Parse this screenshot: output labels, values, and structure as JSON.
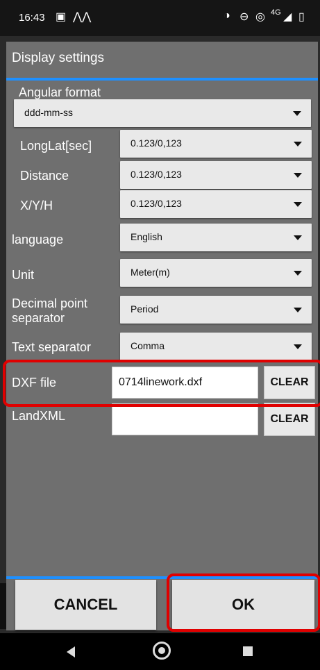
{
  "status": {
    "time": "16:43",
    "network": "4G"
  },
  "dialog": {
    "title": "Display settings",
    "angular_format": {
      "label": "Angular format",
      "value": "ddd-mm-ss"
    },
    "longlat": {
      "label": "LongLat[sec]",
      "value": "0.123/0,123"
    },
    "distance": {
      "label": "Distance",
      "value": "0.123/0,123"
    },
    "xyh": {
      "label": "X/Y/H",
      "value": "0.123/0,123"
    },
    "language": {
      "label": "language",
      "value": "English"
    },
    "unit": {
      "label": "Unit",
      "value": "Meter(m)"
    },
    "decimal": {
      "label": "Decimal point separator",
      "value": "Period"
    },
    "text_sep": {
      "label": "Text separator",
      "value": "Comma"
    },
    "dxf": {
      "label": "DXF file",
      "value": "0714linework.dxf",
      "clear": "CLEAR"
    },
    "landxml": {
      "label": "LandXML",
      "value": "",
      "clear": "CLEAR"
    },
    "cancel": "CANCEL",
    "ok": "OK"
  },
  "colors": {
    "accent": "#1e90ff",
    "highlight": "#e00000",
    "dialog_bg": "#6f6f6f"
  }
}
